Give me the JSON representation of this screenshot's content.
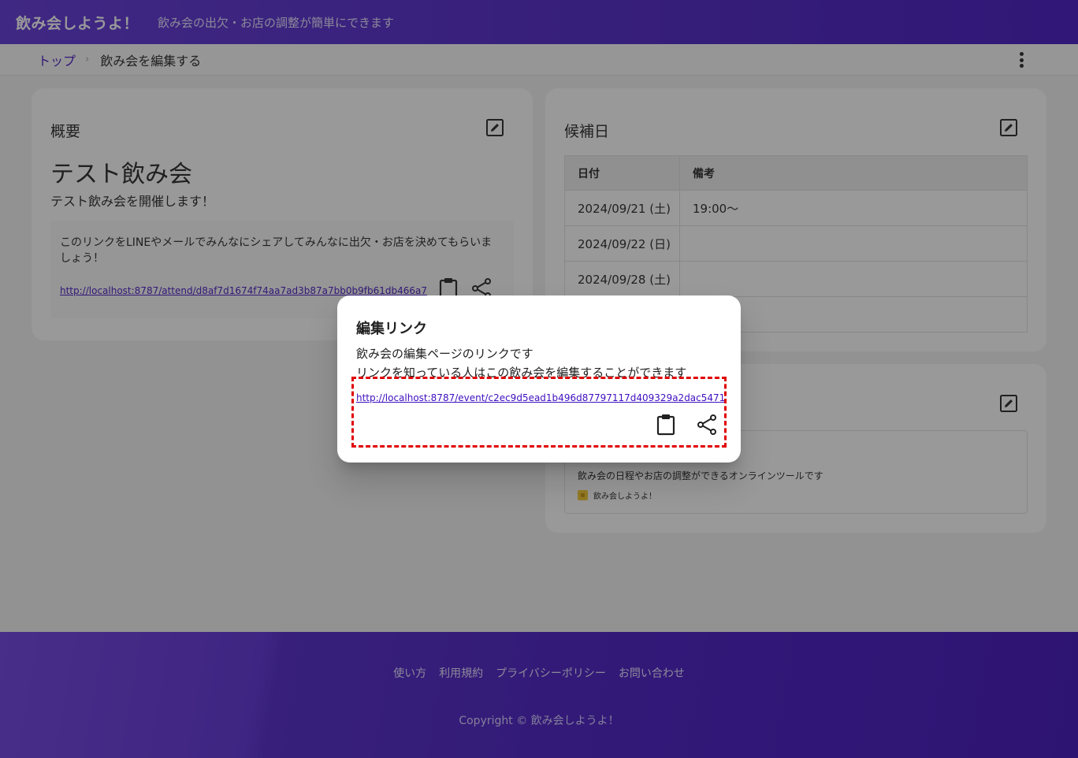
{
  "header": {
    "brand": "飲み会しようよ！",
    "tagline": "飲み会の出欠・お店の調整が簡単にできます"
  },
  "breadcrumb": {
    "top": "トップ",
    "separator": "›",
    "current": "飲み会を編集する"
  },
  "summary": {
    "title": "概要",
    "event_name": "テスト飲み会",
    "event_description": "テスト飲み会を開催します！",
    "share_text": "このリンクをLINEやメールでみんなにシェアしてみんなに出欠・お店を決めてもらいましょう！",
    "attend_link": "http://localhost:8787/attend/d8af7d1674f74aa7ad3b87a7bb0b9fb61db466a7"
  },
  "dates": {
    "title": "候補日",
    "columns": [
      "日付",
      "備考"
    ],
    "rows": [
      {
        "date": "2024/09/21 (土)",
        "note": "19:00～"
      },
      {
        "date": "2024/09/22 (日)",
        "note": ""
      },
      {
        "date": "2024/09/28 (土)",
        "note": ""
      },
      {
        "date": "",
        "note": ""
      }
    ]
  },
  "venue": {
    "description": "飲み会の日程やお店の調整ができるオンラインツールです",
    "site_name": "飲み会しようよ！"
  },
  "footer": {
    "links": [
      "使い方",
      "利用規約",
      "プライバシーポリシー",
      "お問い合わせ"
    ],
    "copyright": "Copyright © 飲み会しようよ！"
  },
  "dialog": {
    "title": "編集リンク",
    "line1": "飲み会の編集ページのリンクです",
    "line2": "リンクを知っている人はこの飲み会を編集することができます",
    "edit_link": "http://localhost:8787/event/c2ec9d5ead1b496d87797117d409329a2dac5471"
  },
  "icons": {
    "edit": "pencil-box-icon",
    "copy": "clipboard-icon",
    "share": "share-icon",
    "menu": "kebab-menu-icon"
  },
  "colors": {
    "brand": "#3f0fc0",
    "highlight": "#e00000"
  }
}
